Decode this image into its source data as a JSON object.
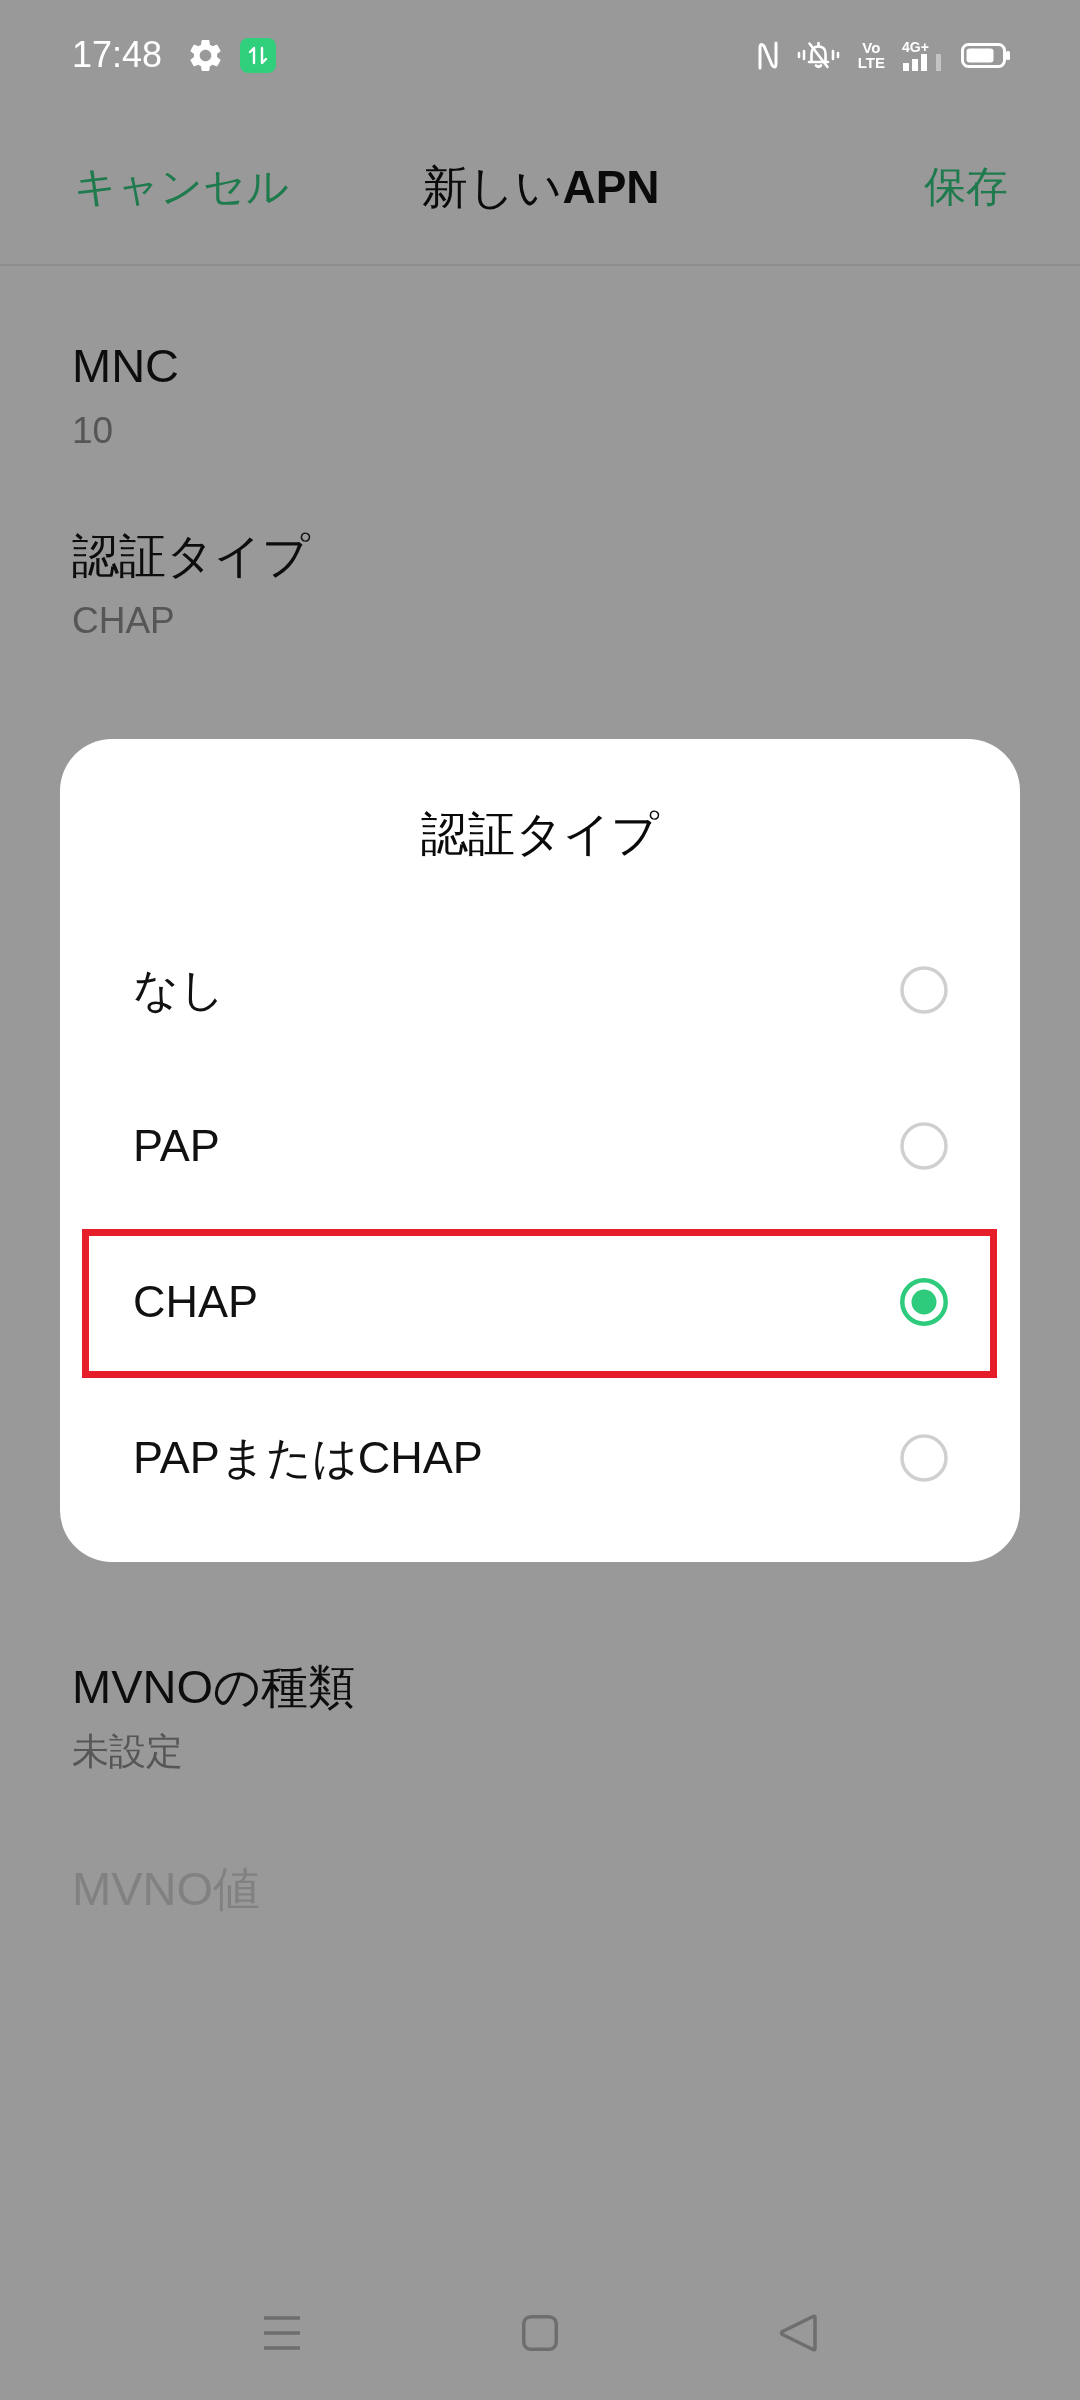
{
  "status_bar": {
    "time": "17:48",
    "volte": "Vo LTE",
    "network": "4G+"
  },
  "header": {
    "cancel": "キャンセル",
    "title": "新しい**APN**",
    "save": "保存"
  },
  "settings_above_dialog": [
    {
      "title": "MNC",
      "value": "10",
      "disabled": false
    },
    {
      "title": "認証タイプ",
      "value": "CHAP",
      "disabled": false
    }
  ],
  "settings_below_dialog": [
    {
      "title": "MVNOの種類",
      "value": "未設定",
      "disabled": false
    },
    {
      "title": "MVNO値",
      "disabled": true
    }
  ],
  "dialog": {
    "title": "認証タイプ",
    "options": [
      {
        "label": "なし",
        "selected": false,
        "highlighted": false
      },
      {
        "label": "PAP",
        "selected": false,
        "highlighted": false
      },
      {
        "label": "CHAP",
        "selected": true,
        "highlighted": true
      },
      {
        "label": "PAPまたはCHAP",
        "selected": false,
        "highlighted": false
      }
    ]
  }
}
